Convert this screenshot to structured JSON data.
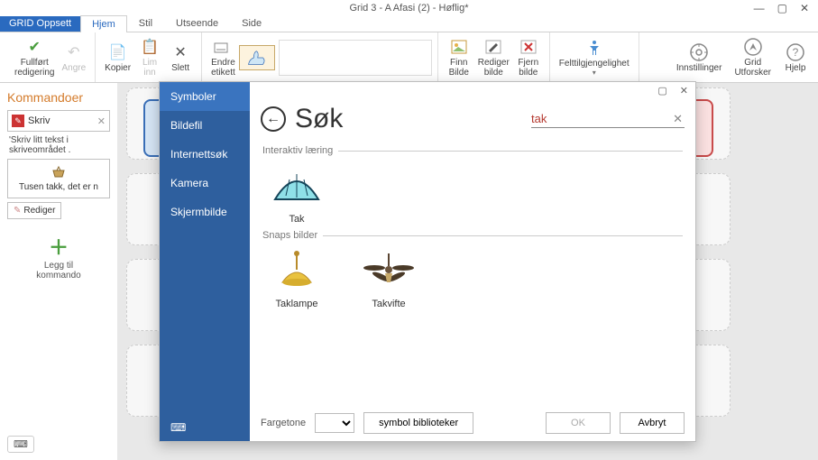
{
  "window": {
    "title": "Grid 3 - A Afasi (2) - Høflig*"
  },
  "tabs": {
    "file": "GRID Oppsett",
    "home": "Hjem",
    "style": "Stil",
    "look": "Utseende",
    "page": "Side"
  },
  "ribbon": {
    "finish": "Fullført\nredigering",
    "undo": "Angre",
    "copy": "Kopier",
    "paste": "Lim\ninn",
    "delete": "Slett",
    "label": "Endre\netikett",
    "findimg": "Finn\nBilde",
    "editimg": "Rediger\nbilde",
    "removeimg": "Fjern\nbilde",
    "access": "Felttilgjengelighet",
    "settings": "Innstillinger",
    "explorer": "Grid\nUtforsker",
    "help": "Hjelp"
  },
  "side": {
    "heading": "Kommandoer",
    "write": "Skriv",
    "desc": "'Skriv litt tekst i skriveområdet .",
    "sample": "Tusen takk, det er n",
    "edit": "Rediger",
    "add": "Legg til\nkommando"
  },
  "dialog": {
    "tabs": {
      "symbols": "Symboler",
      "imagefile": "Bildefil",
      "websearch": "Internettsøk",
      "camera": "Kamera",
      "screenshot": "Skjermbilde"
    },
    "searchTitle": "Søk",
    "query": "tak",
    "cat1": "Interaktiv læring",
    "cat2": "Snaps bilder",
    "results1": [
      {
        "label": "Tak"
      }
    ],
    "results2": [
      {
        "label": "Taklampe"
      },
      {
        "label": "Takvifte"
      }
    ],
    "hue": "Fargetone",
    "libs": "symbol biblioteker",
    "ok": "OK",
    "cancel": "Avbryt"
  }
}
